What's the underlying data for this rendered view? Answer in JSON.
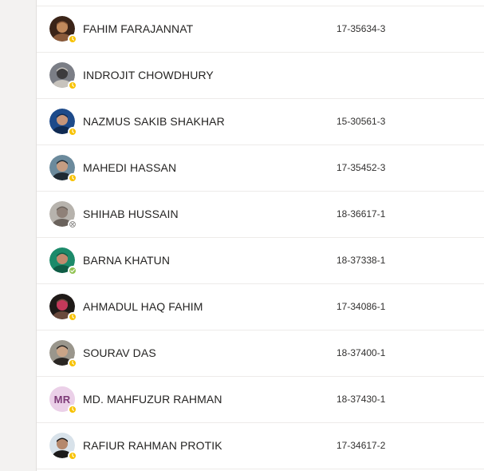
{
  "members": [
    {
      "name": "FAHIM FARAJANNAT",
      "student_id": "17-35634-3",
      "presence": "away",
      "avatar": "photo",
      "photo_colors": [
        "#3b2418",
        "#8a5a3a",
        "#c28a5c"
      ]
    },
    {
      "name": "INDROJIT CHOWDHURY",
      "student_id": "",
      "presence": "away",
      "avatar": "photo",
      "photo_colors": [
        "#7b7e86",
        "#c7c3bd",
        "#3c3b3d"
      ]
    },
    {
      "name": "NAZMUS SAKIB SHAKHAR",
      "student_id": "15-30561-3",
      "presence": "away",
      "avatar": "photo",
      "photo_colors": [
        "#1d4a8a",
        "#0f2a52",
        "#c6957a"
      ]
    },
    {
      "name": "MAHEDI HASSAN",
      "student_id": "17-35452-3",
      "presence": "away",
      "avatar": "photo",
      "photo_colors": [
        "#6b8a9c",
        "#1e2a33",
        "#c59d82"
      ]
    },
    {
      "name": "SHIHAB HUSSAIN",
      "student_id": "18-36617-1",
      "presence": "offline",
      "avatar": "photo",
      "photo_colors": [
        "#b7b3ad",
        "#6a625c",
        "#8f8178"
      ]
    },
    {
      "name": "BARNA KHATUN",
      "student_id": "18-37338-1",
      "presence": "available",
      "avatar": "photo",
      "photo_colors": [
        "#1c8a6a",
        "#0f5c45",
        "#c08a6e"
      ]
    },
    {
      "name": "AHMADUL HAQ FAHIM",
      "student_id": "17-34086-1",
      "presence": "away",
      "avatar": "photo",
      "photo_colors": [
        "#1f1a18",
        "#6a4a3d",
        "#c4395a"
      ]
    },
    {
      "name": "SOURAV DAS",
      "student_id": "18-37400-1",
      "presence": "away",
      "avatar": "photo",
      "photo_colors": [
        "#9a968c",
        "#2a2623",
        "#c9a487"
      ]
    },
    {
      "name": "MD. MAHFUZUR RAHMAN",
      "student_id": "18-37430-1",
      "presence": "away",
      "avatar": "initials",
      "initials": "MR"
    },
    {
      "name": "RAFIUR RAHMAN PROTIK",
      "student_id": "17-34617-2",
      "presence": "away",
      "avatar": "photo",
      "photo_colors": [
        "#d8e2ea",
        "#1b1a1a",
        "#b5886c"
      ]
    }
  ],
  "presence_colors": {
    "away": "#f8c200",
    "available": "#92c353",
    "offline": "#8a8886"
  }
}
